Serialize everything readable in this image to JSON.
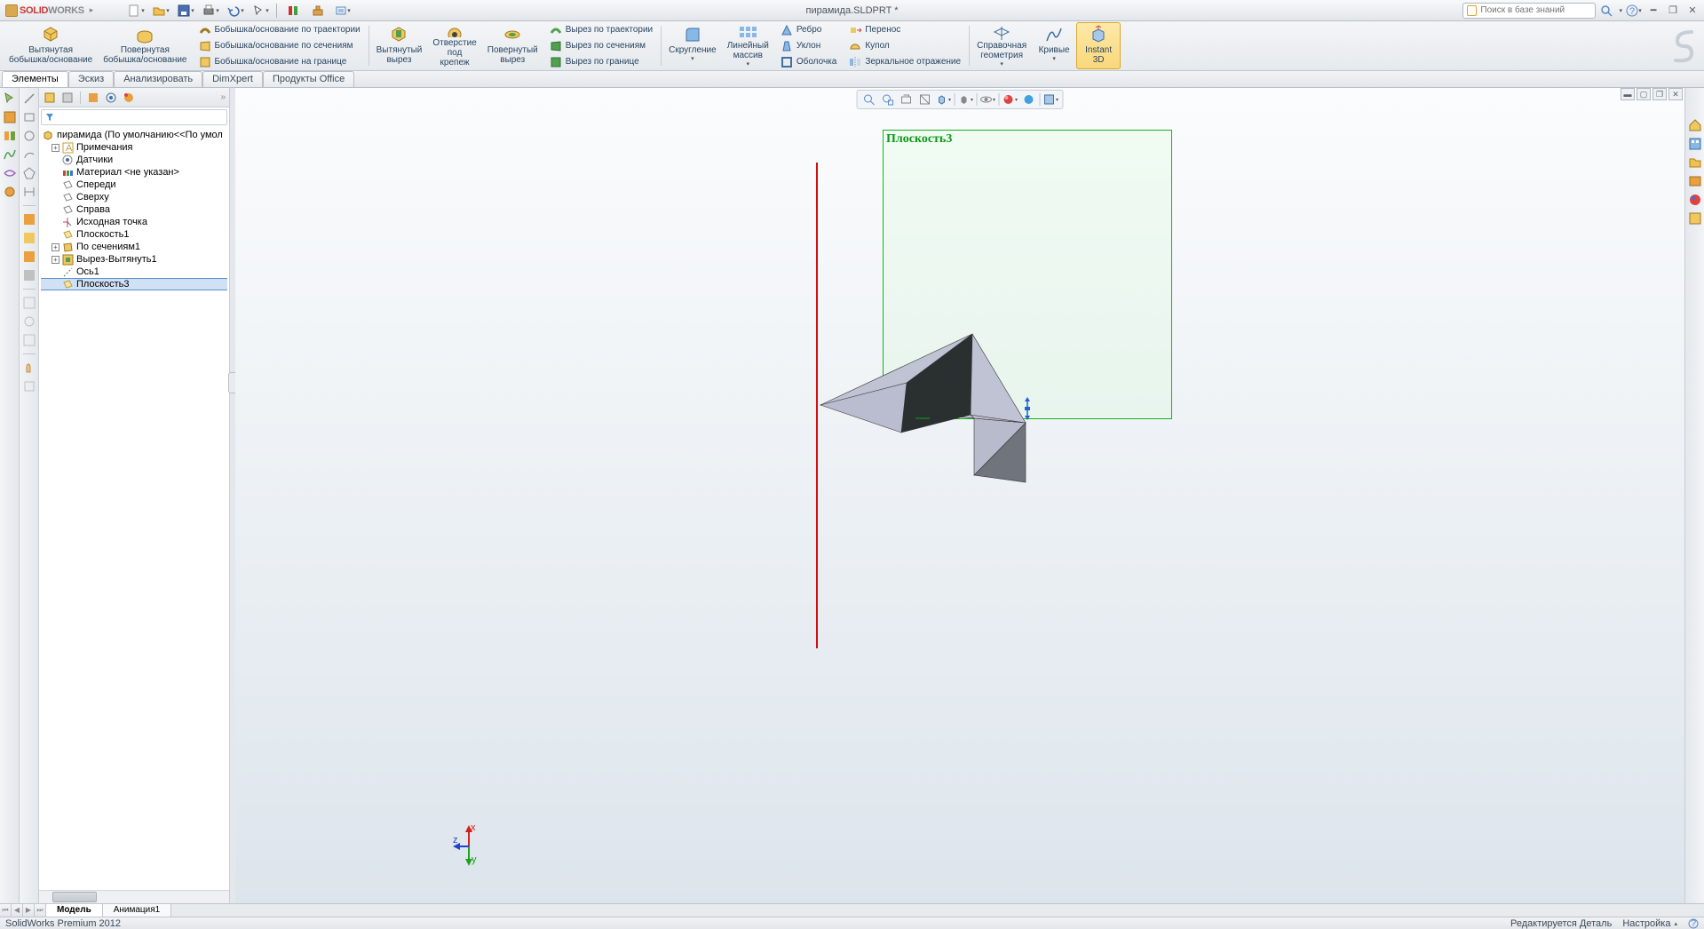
{
  "title": {
    "logo_solid": "SOLID",
    "logo_works": "WORKS",
    "document": "пирамида.SLDPRT *",
    "search_placeholder": "Поиск в базе знаний"
  },
  "ribbon": {
    "extruded_boss": "Вытянутая\nбобышка/основание",
    "revolved_boss": "Повернутая\nбобышка/основание",
    "swept_boss": "Бобышка/основание по траектории",
    "lofted_boss": "Бобышка/основание по сечениям",
    "boundary_boss": "Бобышка/основание на границе",
    "extruded_cut": "Вытянутый\nвырез",
    "hole_wizard": "Отверстие\nпод\nкрепеж",
    "revolved_cut": "Повернутый\nвырез",
    "swept_cut": "Вырез по траектории",
    "lofted_cut": "Вырез по сечениям",
    "boundary_cut": "Вырез по границе",
    "fillet": "Скругление",
    "linear_pattern": "Линейный\nмассив",
    "rib": "Ребро",
    "draft": "Уклон",
    "shell": "Оболочка",
    "move": "Перенос",
    "dome": "Купол",
    "mirror": "Зеркальное отражение",
    "ref_geom": "Справочная\n геометрия",
    "curves": "Кривые",
    "instant3d": "Instant\n3D"
  },
  "tabs": {
    "features": "Элементы",
    "sketch": "Эскиз",
    "analyze": "Анализировать",
    "dimxpert": "DimXpert",
    "office": "Продукты Office"
  },
  "tree": {
    "root": "пирамида  (По умолчанию<<По умол",
    "items": [
      {
        "label": "Примечания",
        "expandable": true
      },
      {
        "label": "Датчики"
      },
      {
        "label": "Материал <не указан>"
      },
      {
        "label": "Спереди"
      },
      {
        "label": "Сверху"
      },
      {
        "label": "Справа"
      },
      {
        "label": "Исходная точка"
      },
      {
        "label": "Плоскость1"
      },
      {
        "label": "По сечениям1",
        "expandable": true
      },
      {
        "label": "Вырез-Вытянуть1",
        "expandable": true
      },
      {
        "label": "Ось1"
      },
      {
        "label": "Плоскость3",
        "selected": true
      }
    ]
  },
  "viewport": {
    "plane_label": "Плоскость3"
  },
  "bottom_tabs": {
    "model": "Модель",
    "anim": "Анимация1"
  },
  "status": {
    "product": "SolidWorks Premium 2012",
    "editing": "Редактируется Деталь",
    "custom": "Настройка"
  }
}
